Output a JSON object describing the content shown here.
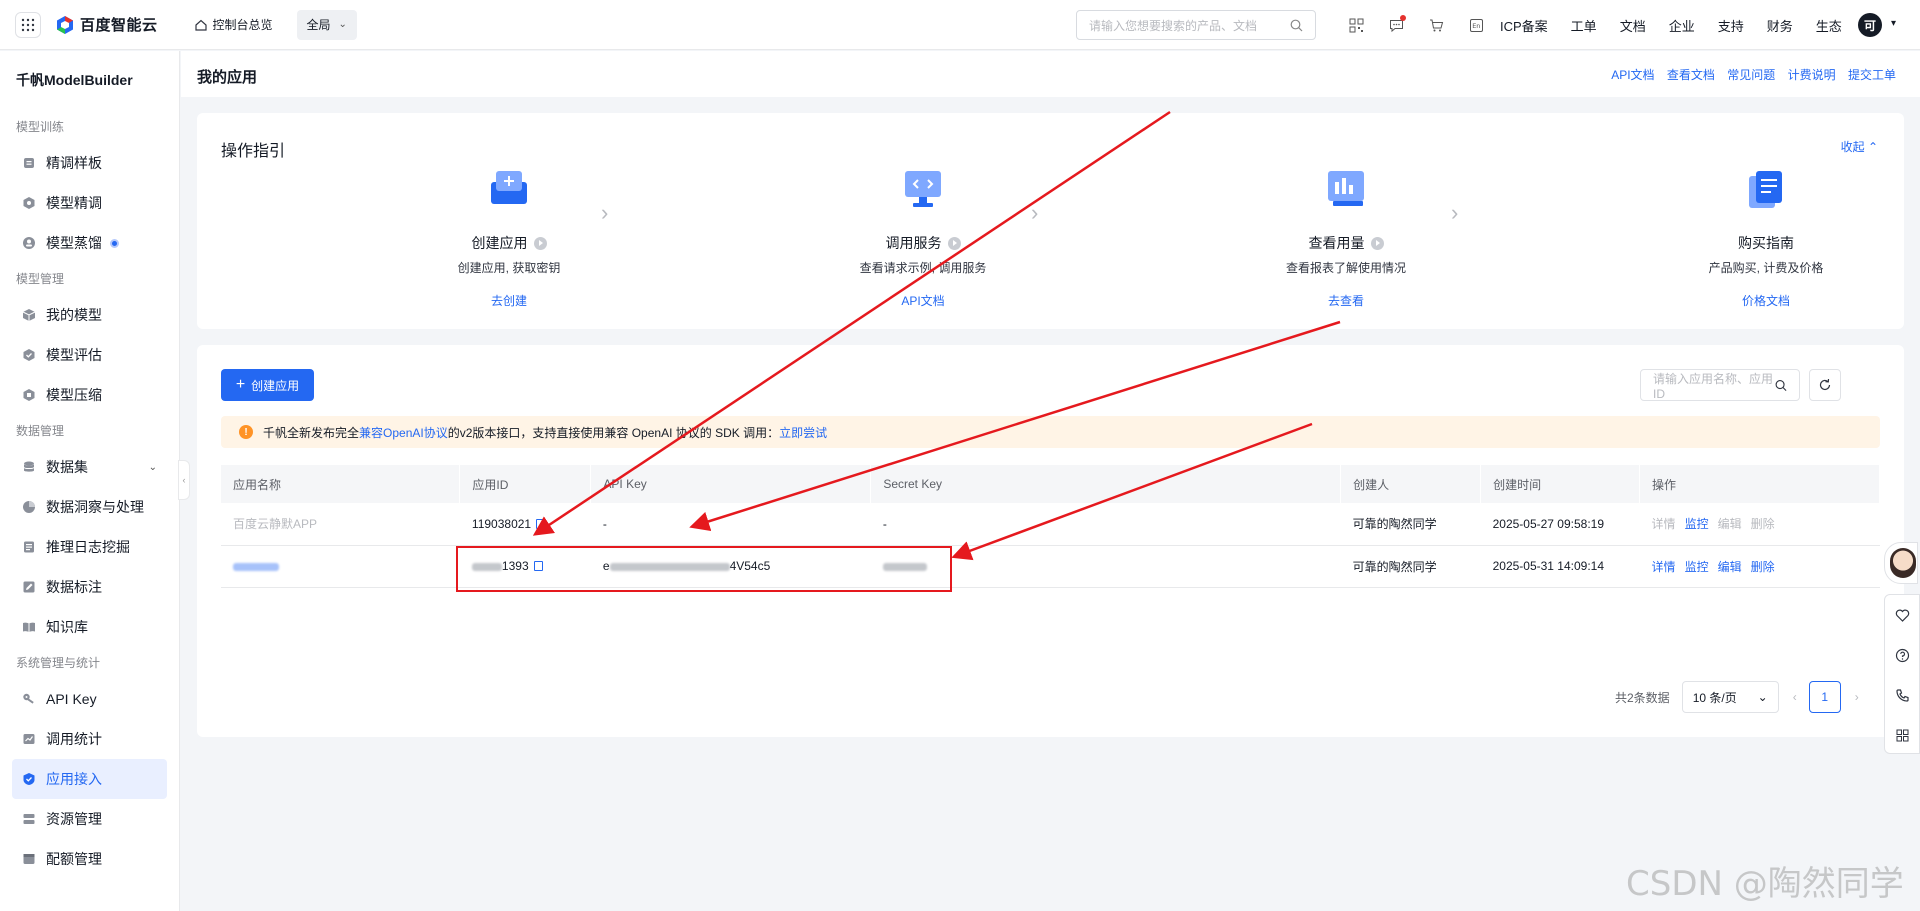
{
  "topbar": {
    "logo_text": "百度智能云",
    "home_label": "控制台总览",
    "region": "全局",
    "search_placeholder": "请输入您想要搜索的产品、文档",
    "links": [
      "ICP备案",
      "工单",
      "文档",
      "企业",
      "支持",
      "财务",
      "生态"
    ],
    "avatar_initial": "可",
    "icons": [
      "qrcode-icon",
      "message-icon",
      "cart-icon",
      "language-icon"
    ]
  },
  "sidebar": {
    "title": "千帆ModelBuilder",
    "groups": [
      {
        "label": "模型训练",
        "items": [
          {
            "label": "精调样板",
            "icon": "template-icon"
          },
          {
            "label": "模型精调",
            "icon": "finetune-icon"
          },
          {
            "label": "模型蒸馏",
            "icon": "distill-icon",
            "badge": true
          }
        ]
      },
      {
        "label": "模型管理",
        "items": [
          {
            "label": "我的模型",
            "icon": "model-icon"
          },
          {
            "label": "模型评估",
            "icon": "evaluate-icon"
          },
          {
            "label": "模型压缩",
            "icon": "compress-icon"
          }
        ]
      },
      {
        "label": "数据管理",
        "items": [
          {
            "label": "数据集",
            "icon": "dataset-icon",
            "expand": true
          },
          {
            "label": "数据洞察与处理",
            "icon": "insight-icon"
          },
          {
            "label": "推理日志挖掘",
            "icon": "log-icon"
          },
          {
            "label": "数据标注",
            "icon": "annotate-icon"
          },
          {
            "label": "知识库",
            "icon": "knowledge-icon"
          }
        ]
      },
      {
        "label": "系统管理与统计",
        "items": [
          {
            "label": "API Key",
            "icon": "key-icon"
          },
          {
            "label": "调用统计",
            "icon": "stats-icon"
          },
          {
            "label": "应用接入",
            "icon": "app-icon",
            "active": true
          },
          {
            "label": "资源管理",
            "icon": "resource-icon"
          },
          {
            "label": "配额管理",
            "icon": "quota-icon"
          }
        ]
      }
    ]
  },
  "page": {
    "title": "我的应用",
    "head_links": [
      "API文档",
      "查看文档",
      "常见问题",
      "计费说明",
      "提交工单"
    ]
  },
  "guide": {
    "title": "操作指引",
    "collapse_label": "收起",
    "steps": [
      {
        "name": "创建应用",
        "desc": "创建应用, 获取密钥",
        "link": "去创建"
      },
      {
        "name": "调用服务",
        "desc": "查看请求示例, 调用服务",
        "link": "API文档"
      },
      {
        "name": "查看用量",
        "desc": "查看报表了解使用情况",
        "link": "去查看"
      },
      {
        "name": "购买指南",
        "desc": "产品购买, 计费及价格",
        "link": "价格文档"
      }
    ]
  },
  "apps": {
    "create_label": "创建应用",
    "search_placeholder": "请输入应用名称、应用ID",
    "notice": {
      "prefix": "千帆全新发布完全",
      "link1": "兼容OpenAI协议",
      "middle": "的v2版本接口，支持直接使用兼容 OpenAI 协议的 SDK 调用：",
      "link2": "立即尝试"
    },
    "columns": [
      "应用名称",
      "应用ID",
      "API Key",
      "Secret Key",
      "创建人",
      "创建时间",
      "操作"
    ],
    "rows": [
      {
        "name": "百度云静默APP",
        "app_id": "119038021",
        "api_key": "-",
        "secret_key": "-",
        "creator": "可靠的陶然同学",
        "created": "2025-05-27 09:58:19",
        "ops": [
          "详情",
          "监控",
          "编辑",
          "删除"
        ]
      },
      {
        "name": "",
        "app_id": "1393",
        "api_key_prefix": "e",
        "api_key_suffix": "4V54c5",
        "secret_key": "",
        "creator": "可靠的陶然同学",
        "created": "2025-05-31 14:09:14",
        "ops": [
          "详情",
          "监控",
          "编辑",
          "删除"
        ]
      }
    ],
    "pagination": {
      "total": "共2条数据",
      "page_size": "10 条/页",
      "current": "1"
    }
  },
  "watermark": "CSDN @陶然同学",
  "colors": {
    "accent": "#2468f2",
    "annotation": "#e5191e",
    "warning": "#ff9326"
  }
}
